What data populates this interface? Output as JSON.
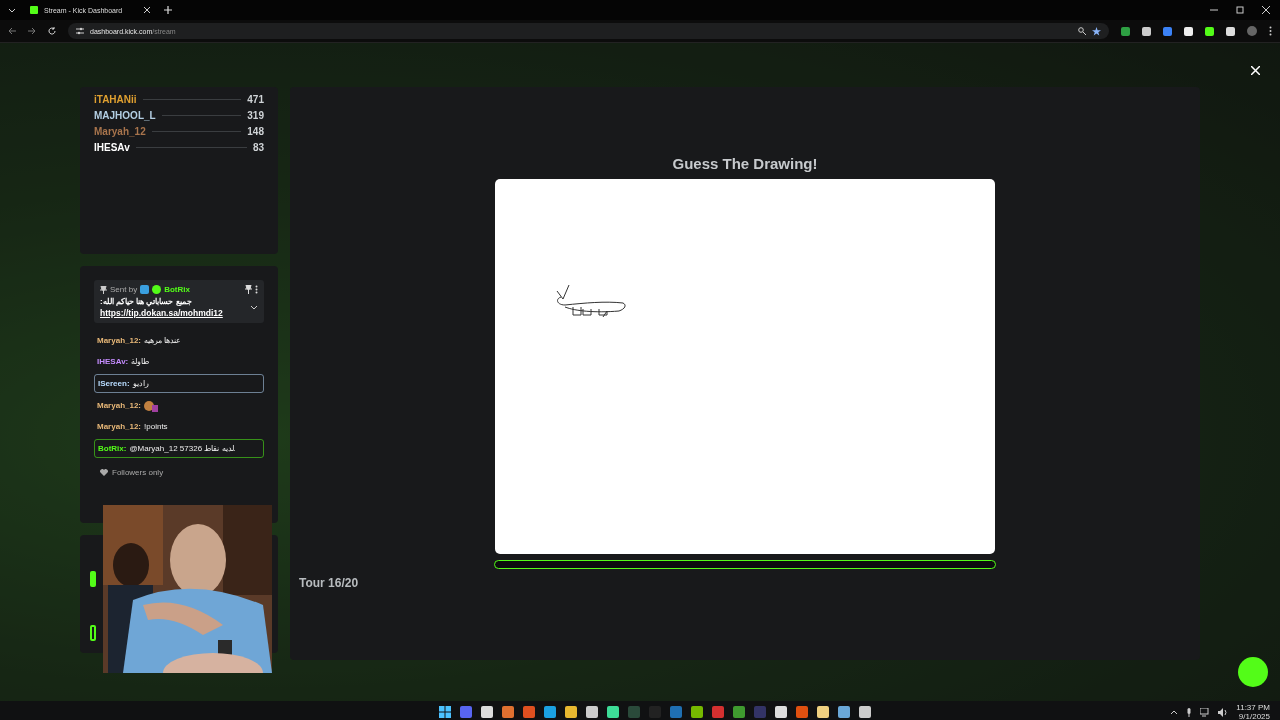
{
  "browser": {
    "tab_title": "Stream - Kick Dashboard",
    "url_host": "dashboard.kick.com",
    "url_path": "/stream"
  },
  "leaderboard": [
    {
      "name": "iTAHANii",
      "score": "471",
      "color": "#e0a030"
    },
    {
      "name": "MAJHOOL_L",
      "score": "319",
      "color": "#b4cfe3"
    },
    {
      "name": "Maryah_12",
      "score": "148",
      "color": "#a8744c"
    },
    {
      "name": "IHESAv",
      "score": "83",
      "color": "#ffffff"
    }
  ],
  "pinned": {
    "sent_by": "Sent by",
    "user": "BotRix",
    "text": "جمبع حساباتي هنا حياكم الله:",
    "link": "https://tip.dokan.sa/mohmdi12"
  },
  "chat": [
    {
      "kind": "plain",
      "user": "Maryah_12:",
      "color": "#e8b878",
      "text": "عندها مرهيه"
    },
    {
      "kind": "plain",
      "user": "IHESAv:",
      "color": "#c58cff",
      "text": "طاولة"
    },
    {
      "kind": "highlight",
      "user": "ISereen:",
      "color": "#b8dcff",
      "text": "راديو"
    },
    {
      "kind": "emote",
      "user": "Maryah_12:",
      "color": "#e8b878"
    },
    {
      "kind": "plain",
      "user": "Maryah_12:",
      "color": "#e8b878",
      "text": "!points"
    },
    {
      "kind": "highlight",
      "user": "BotRix:",
      "color": "#53fc18",
      "text": "@Maryah_12 لديه نقاط 57326."
    }
  ],
  "chat_mode": "Followers only",
  "game": {
    "title": "Guess The Drawing!",
    "timer": {
      "level": 0
    },
    "round": "Tour 16/20"
  },
  "taskbar": {
    "time": "11:37 PM",
    "date": "9/1/2025"
  }
}
